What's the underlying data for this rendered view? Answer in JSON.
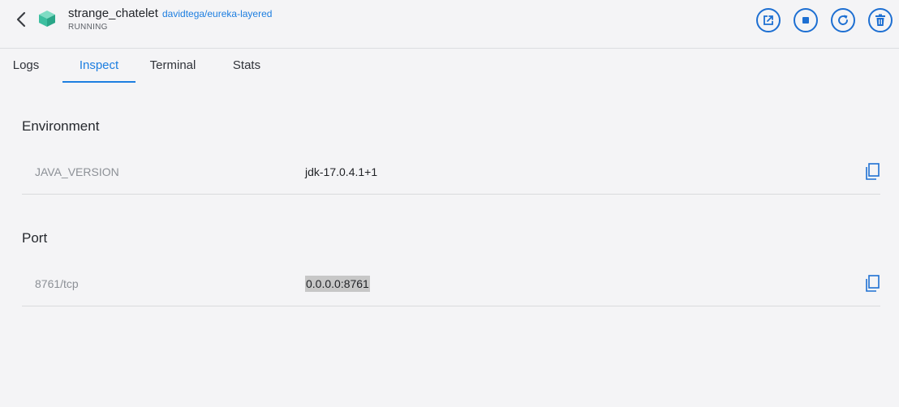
{
  "header": {
    "container_name": "strange_chatelet",
    "image": "davidtega/eureka-layered",
    "status": "RUNNING",
    "actions": [
      "open-in-browser",
      "stop",
      "restart",
      "delete"
    ]
  },
  "tabs": [
    {
      "label": "Logs",
      "active": false
    },
    {
      "label": "Inspect",
      "active": true
    },
    {
      "label": "Terminal",
      "active": false
    },
    {
      "label": "Stats",
      "active": false
    }
  ],
  "environment": {
    "title": "Environment",
    "rows": [
      {
        "key": "JAVA_VERSION",
        "value": "jdk-17.0.4.1+1"
      }
    ]
  },
  "port": {
    "title": "Port",
    "rows": [
      {
        "key": "8761/tcp",
        "value": "0.0.0.0:8761",
        "selected": true
      }
    ]
  },
  "colors": {
    "accent": "#1d7ee0",
    "icon_blue": "#1d6fd2",
    "container_icon": "#3dbfa0",
    "background": "#f4f4f6"
  }
}
